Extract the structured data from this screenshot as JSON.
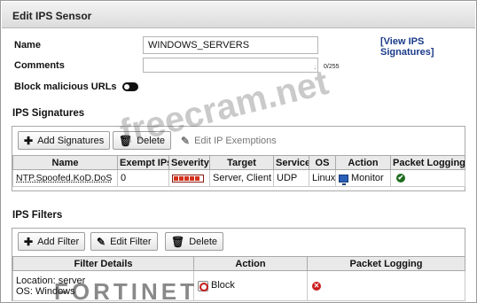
{
  "dialog": {
    "title": "Edit IPS Sensor"
  },
  "form": {
    "name_label": "Name",
    "name_value": "WINDOWS_SERVERS",
    "comments_label": "Comments",
    "comments_counter": "0/255",
    "block_urls_label": "Block malicious URLs",
    "block_urls_enabled": false,
    "view_signatures_link": "[View IPS Signatures]"
  },
  "signatures": {
    "section_title": "IPS Signatures",
    "toolbar": {
      "add_label": "Add Signatures",
      "delete_label": "Delete",
      "edit_exemptions_label": "Edit IP Exemptions"
    },
    "columns": [
      "Name",
      "Exempt IPs",
      "Severity",
      "Target",
      "Service",
      "OS",
      "Action",
      "Packet Logging"
    ],
    "rows": [
      {
        "name": "NTP.Spoofed.KoD.DoS",
        "exempt_ips": "0",
        "severity_level": 5,
        "target": "Server, Client",
        "service": "UDP",
        "os": "Linux",
        "action": "Monitor",
        "action_icon": "monitor-icon",
        "packet_logging": "enabled",
        "packet_logging_icon": "check-circle-icon"
      }
    ]
  },
  "filters": {
    "section_title": "IPS Filters",
    "toolbar": {
      "add_label": "Add Filter",
      "edit_label": "Edit Filter",
      "delete_label": "Delete"
    },
    "columns": [
      "Filter Details",
      "Action",
      "Packet Logging"
    ],
    "rows": [
      {
        "details_line1": "Location: server",
        "details_line2": "OS: Windows",
        "action": "Block",
        "action_icon": "block-icon",
        "packet_logging": "disabled",
        "packet_logging_icon": "x-circle-icon"
      }
    ]
  },
  "watermarks": {
    "site": "freecram.net",
    "brand": "FORTINET"
  },
  "colors": {
    "link": "#1a3a8a",
    "severity_red": "#d2311c",
    "check_green": "#1f6d1f",
    "x_red": "#c91c1c",
    "monitor_blue": "#2a5fb8"
  }
}
